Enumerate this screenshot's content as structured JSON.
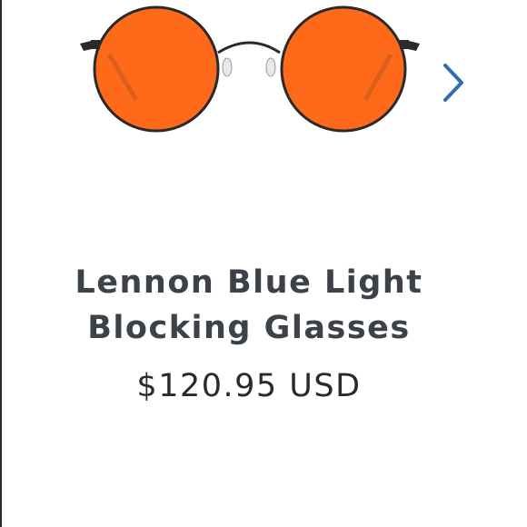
{
  "product": {
    "title_line1": "Lennon Blue Light",
    "title_line2": "Blocking Glasses",
    "price": "$120.95 USD",
    "lens_color": "#ff6a1a",
    "frame_color": "#2a2a2a"
  },
  "carousel": {
    "next_icon": "chevron-right-icon",
    "accent": "#2f6fb1"
  }
}
